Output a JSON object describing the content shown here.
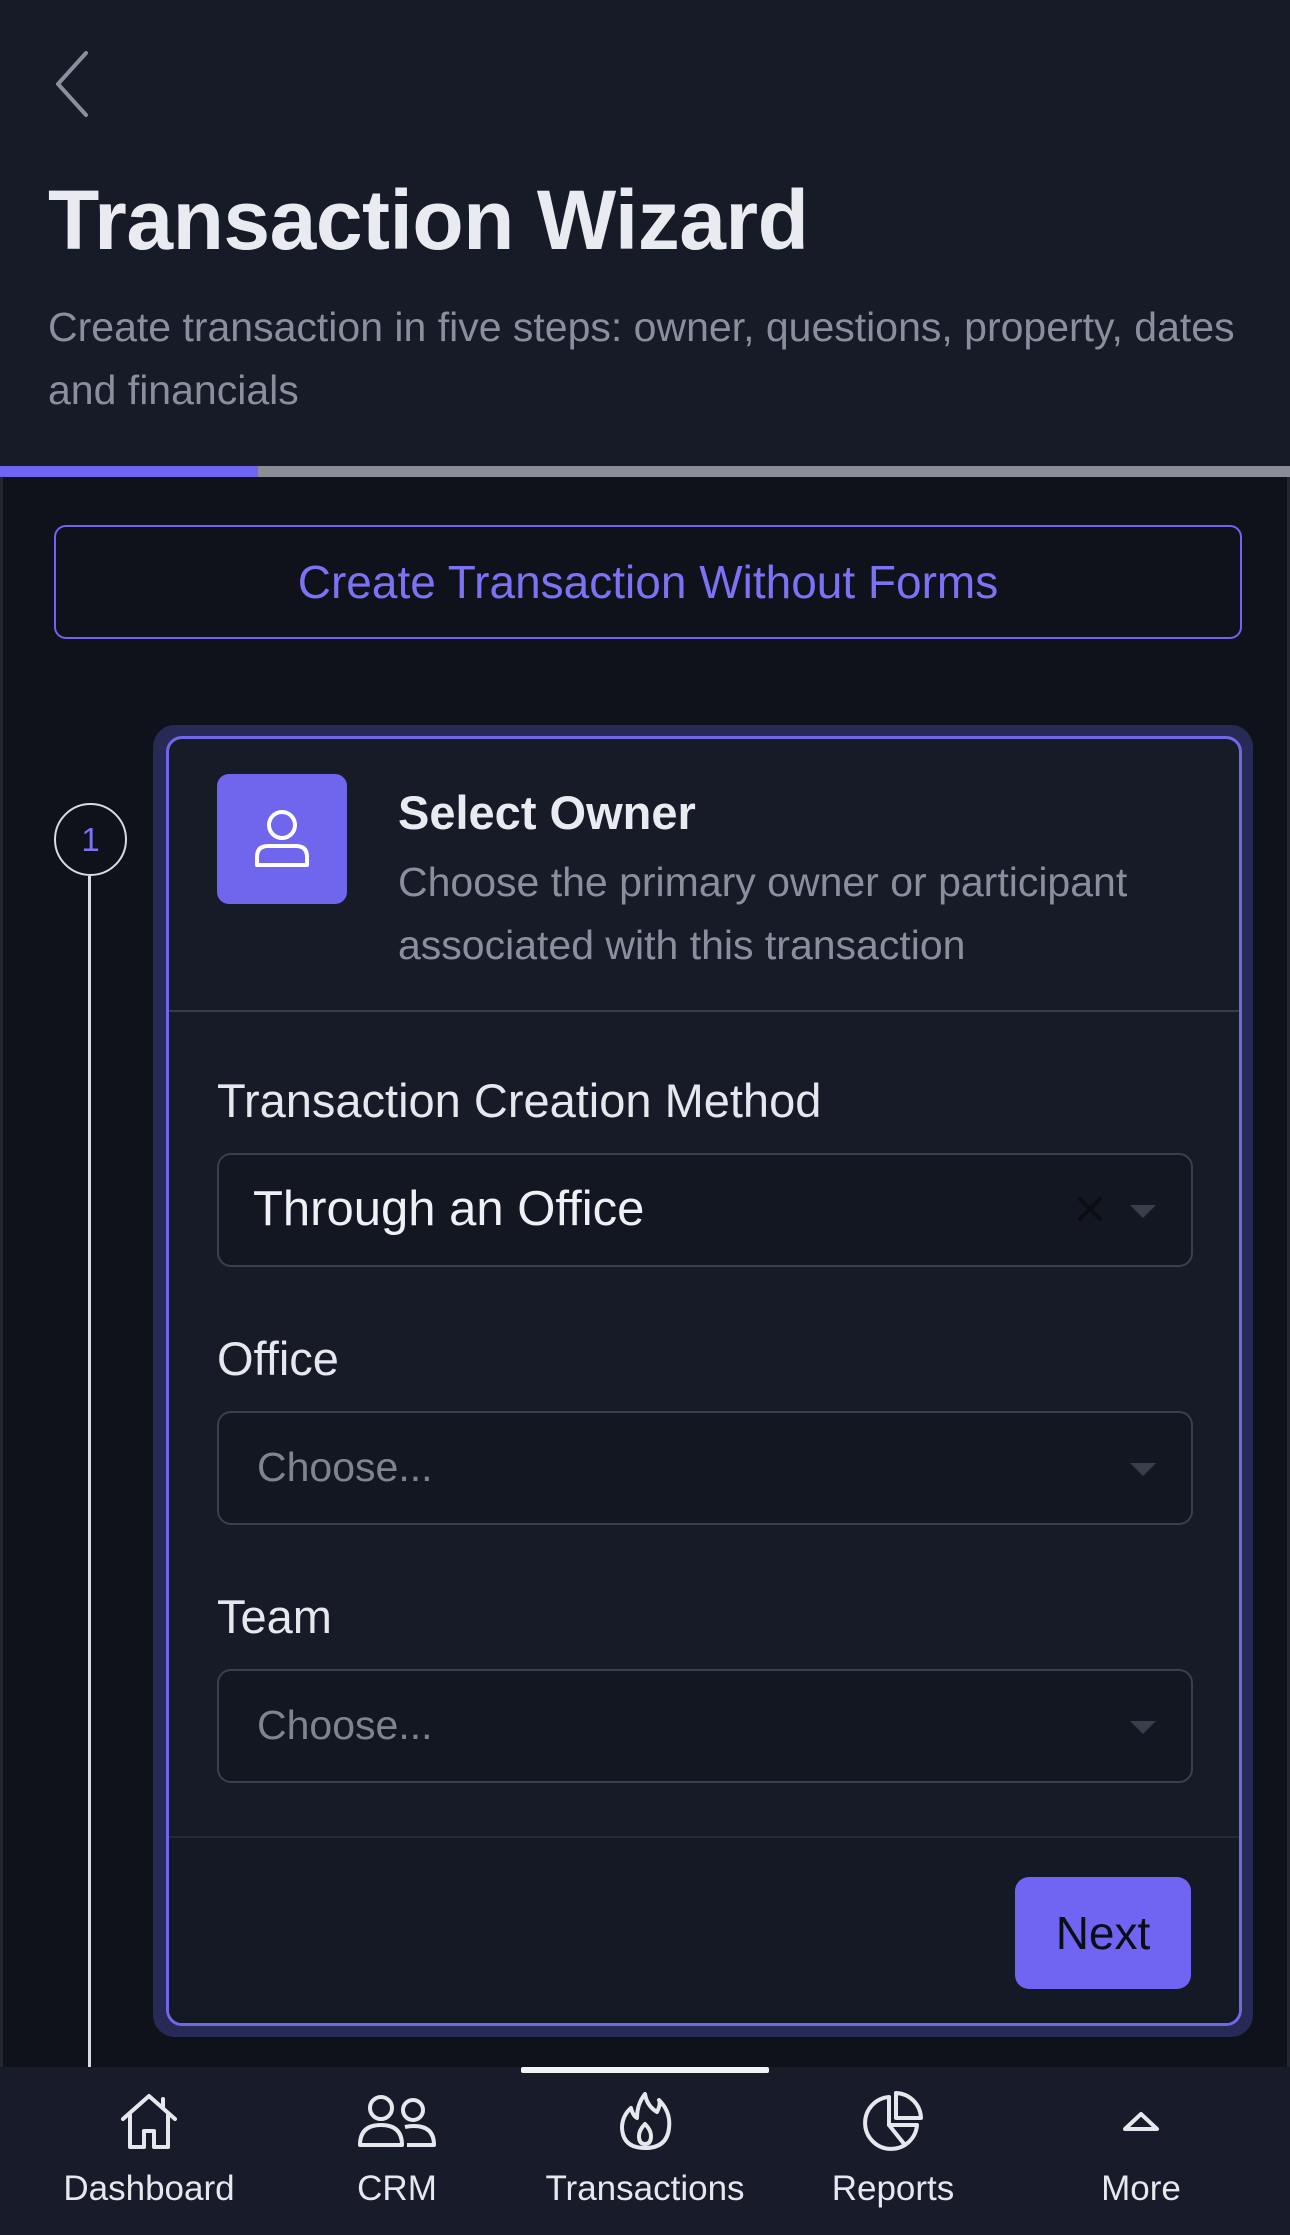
{
  "header": {
    "title": "Transaction Wizard",
    "subtitle": "Create transaction in five steps: owner, questions, property, dates and financials",
    "back_icon": "chevron-left-icon"
  },
  "progress": {
    "fraction": 0.2
  },
  "actions": {
    "no_forms_label": "Create Transaction Without Forms"
  },
  "step": {
    "number": "1",
    "title": "Select Owner",
    "description": "Choose the primary owner or participant associated with this transaction",
    "icon": "user-icon"
  },
  "form": {
    "method": {
      "label": "Transaction Creation Method",
      "value": "Through an Office"
    },
    "office": {
      "label": "Office",
      "placeholder": "Choose..."
    },
    "team": {
      "label": "Team",
      "placeholder": "Choose..."
    },
    "next_label": "Next"
  },
  "nav": {
    "items": [
      {
        "label": "Dashboard",
        "icon": "home-icon"
      },
      {
        "label": "CRM",
        "icon": "users-icon"
      },
      {
        "label": "Transactions",
        "icon": "flame-icon",
        "active": true
      },
      {
        "label": "Reports",
        "icon": "pie-chart-icon"
      },
      {
        "label": "More",
        "icon": "chevron-up-icon"
      }
    ]
  },
  "colors": {
    "accent": "#6f65f2",
    "background": "#0f121b",
    "header": "#171b28"
  }
}
